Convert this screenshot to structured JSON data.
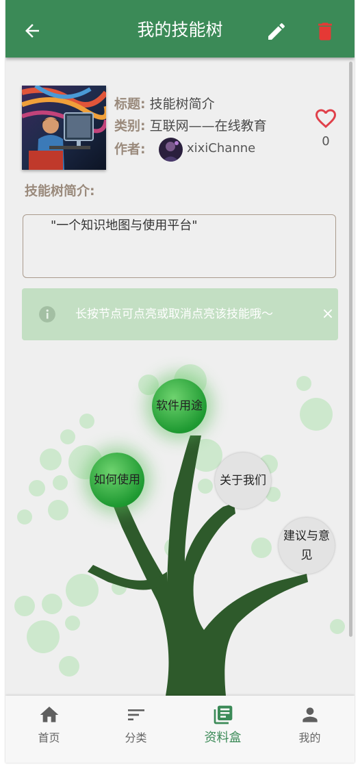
{
  "appbar": {
    "title": "我的技能树",
    "bg_color": "#3b8a57",
    "icons": [
      "arrow-left-icon",
      "pencil-icon",
      "trash-icon"
    ]
  },
  "tree_info": {
    "title_label": "标题:",
    "title_value": "技能树简介",
    "category_label": "类别:",
    "category_value": "互联网——在线教育",
    "author_label": "作者:",
    "author_name": "xixiChanne",
    "likes": "0"
  },
  "intro": {
    "label": "技能树简介:",
    "text": "\"一个知识地图与使用平台\""
  },
  "tip": {
    "text": "长按节点可点亮或取消点亮该技能哦～",
    "close": "×"
  },
  "skill_nodes": [
    {
      "label": "软件用途",
      "lit": true
    },
    {
      "label": "如何使用",
      "lit": true
    },
    {
      "label": "关于我们",
      "lit": false
    },
    {
      "label": "建议与意见",
      "lit": false
    }
  ],
  "bottom_nav": {
    "items": [
      {
        "label": "首页",
        "icon": "home-icon"
      },
      {
        "label": "分类",
        "icon": "sort-icon"
      },
      {
        "label": "资料盒",
        "icon": "library-books-icon",
        "active": true
      },
      {
        "label": "我的",
        "icon": "person-icon"
      }
    ]
  },
  "colors": {
    "primary": "#3b8a57",
    "heart": "#e0404a",
    "trash": "#e53935",
    "tip_bg": "#c3dfc3",
    "tree": "#2e5a2b"
  }
}
